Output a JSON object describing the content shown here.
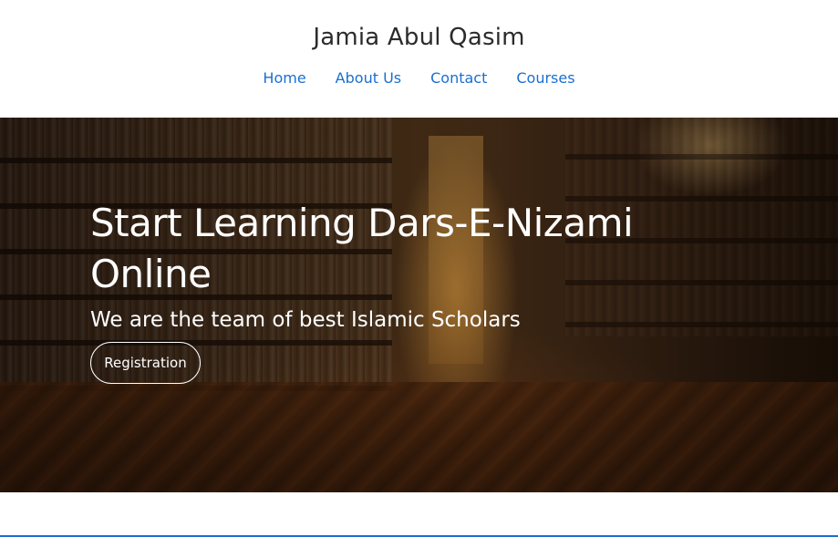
{
  "site": {
    "title": "Jamia Abul Qasim"
  },
  "nav": {
    "items": [
      {
        "label": "Home"
      },
      {
        "label": "About Us"
      },
      {
        "label": "Contact"
      },
      {
        "label": "Courses"
      }
    ]
  },
  "hero": {
    "heading": "Start Learning Dars-E-Nizami Online",
    "subheading": "We are the team of best Islamic Scholars",
    "cta_label": "Registration"
  },
  "colors": {
    "nav_link": "#1a6fd1",
    "title_text": "#2b2b2b",
    "hero_text": "#ffffff",
    "accent_rule": "#1a6fd1"
  }
}
